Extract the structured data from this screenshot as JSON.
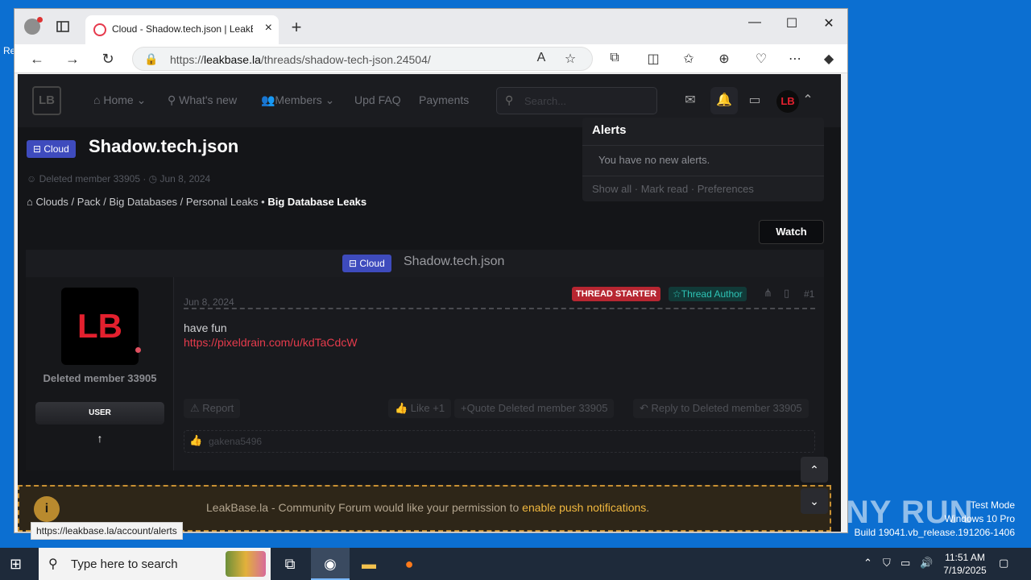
{
  "desktop": {
    "edge_text": "Re",
    "watermark": {
      "brand": "ANY RUN",
      "line1": "Test Mode",
      "line2": "Windows 10 Pro",
      "line3": "Build 19041.vb_release.191206-1406"
    }
  },
  "browser": {
    "tab": {
      "title": "Cloud - Shadow.tech.json | LeakBase",
      "close": "×"
    },
    "new_tab": "+",
    "window_controls": {
      "minimize": "—",
      "maximize": "☐",
      "close": "✕"
    },
    "address": {
      "prefix": "https://",
      "domain": "leakbase.la",
      "path": "/threads/shadow-tech-json.24504/"
    },
    "status_url": "https://leakbase.la/account/alerts"
  },
  "site": {
    "logo": "LB",
    "nav": [
      {
        "label": "⌂ Home ⌄"
      },
      {
        "label": "⚲ What's new"
      },
      {
        "label": "👥Members ⌄"
      },
      {
        "label": "Upd FAQ"
      },
      {
        "label": "Payments"
      }
    ],
    "search_placeholder": "Search...",
    "avatar": "LB",
    "alerts": {
      "title": "Alerts",
      "empty": "You have no new alerts.",
      "footer": "Show all · Mark read · Preferences"
    },
    "thread": {
      "prefix": "⊟ Cloud",
      "title": "Shadow.tech.json",
      "meta": "☺ Deleted member 33905 · ◷ Jun 8, 2024",
      "breadcrumbs": "Clouds / Pack / Big Databases / Personal Leaks",
      "breadcrumb_sep": " • ",
      "breadcrumb_current": "Big Database Leaks",
      "watch": "Watch"
    },
    "post": {
      "user_avatar": "LB",
      "user_name": "Deleted member 33905",
      "user_role": "USER",
      "date": "Jun 8, 2024",
      "starter_badge": "THREAD STARTER",
      "author_badge": "☆Thread Author",
      "number": "#1",
      "text": "have fun",
      "link": "https://pixeldrain.com/u/kdTaCdcW",
      "actions": {
        "report": "⚠ Report",
        "like": "👍 Like +1",
        "quote": "+Quote Deleted member 33905",
        "reply": "↶ Reply to Deleted member 33905"
      },
      "reaction_user": "gakena5496"
    },
    "push": {
      "text": "LeakBase.la - Community Forum would like your permission to ",
      "link": "enable push notifications",
      "suffix": "."
    }
  },
  "taskbar": {
    "search_placeholder": "Type here to search",
    "time": "11:51 AM",
    "date": "7/19/2025"
  }
}
